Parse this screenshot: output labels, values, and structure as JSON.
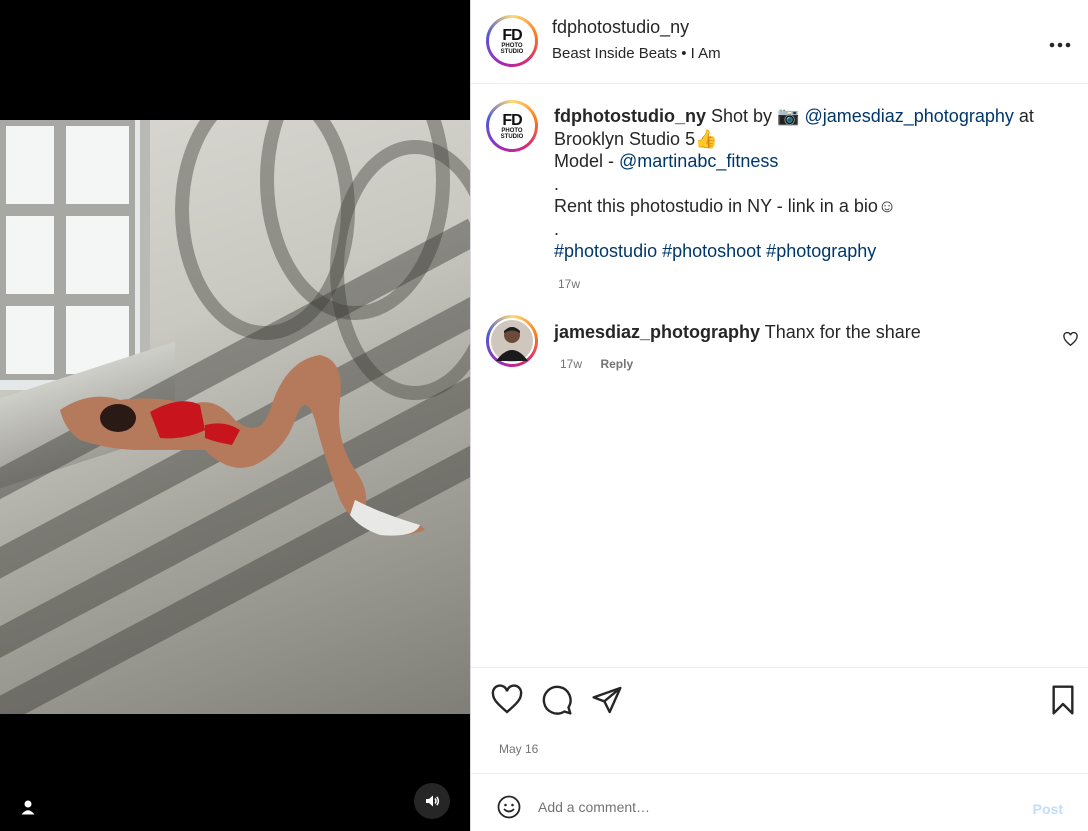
{
  "post": {
    "username": "fdphotostudio_ny",
    "audio": "Beast Inside Beats • I Am",
    "logo_text": "FD",
    "logo_sub": "PHOTO STUDIO"
  },
  "caption": {
    "username": "fdphotostudio_ny",
    "text_1": " Shot by 📷 ",
    "mention_1": "@jamesdiaz_photography",
    "text_2": " at Brooklyn Studio 5👍",
    "text_3": "Model - ",
    "mention_2": "@martinabc_fitness",
    "dot_1": ".",
    "text_4": "Rent this photostudio in NY - link in a bio☺",
    "dot_2": ".",
    "hashtags": "#photostudio #photoshoot #photography",
    "age": "17w"
  },
  "comments": [
    {
      "username": "jamesdiaz_photography",
      "text": " Thanx for the share",
      "age": "17w",
      "reply_label": "Reply"
    }
  ],
  "footer": {
    "date": "May 16",
    "comment_placeholder": "Add a comment…",
    "post_label": "Post"
  },
  "icons": {
    "like": "heart-icon",
    "comment": "comment-icon",
    "share": "share-icon",
    "save": "bookmark-icon",
    "more": "more-icon",
    "emoji": "emoji-icon",
    "audio": "speaker-icon",
    "tagged": "user-icon"
  },
  "colors": {
    "link": "#00376b",
    "muted": "#737373",
    "post_button": "#c0dffd"
  }
}
